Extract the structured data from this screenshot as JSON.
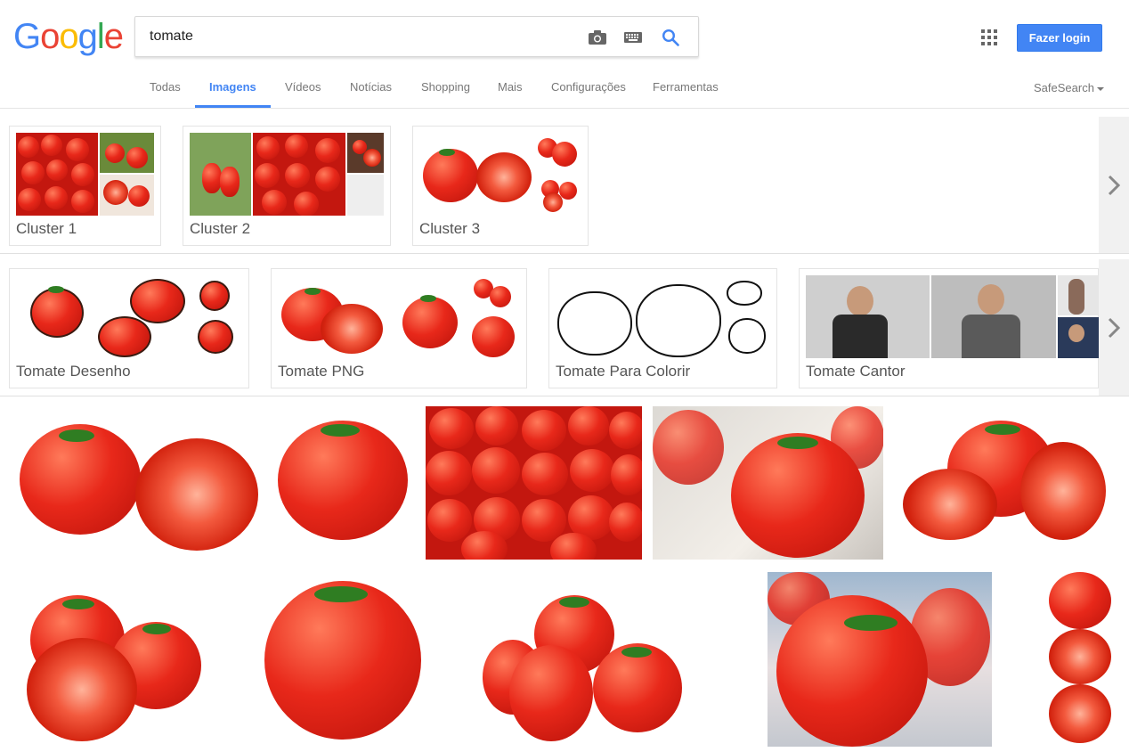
{
  "header": {
    "logo_letters": [
      "G",
      "o",
      "o",
      "g",
      "l",
      "e"
    ],
    "logo_colors": [
      "#4285f4",
      "#ea4335",
      "#fbbc05",
      "#4285f4",
      "#34a853",
      "#ea4335"
    ],
    "search_value": "tomate",
    "login_label": "Fazer login",
    "icons": [
      "camera-icon",
      "keyboard-icon",
      "search-icon",
      "apps-grid-icon"
    ]
  },
  "tabs": {
    "items": [
      "Todas",
      "Imagens",
      "Vídeos",
      "Notícias",
      "Shopping",
      "Mais",
      "Configurações",
      "Ferramentas"
    ],
    "active": "Imagens",
    "safesearch_label": "SafeSearch"
  },
  "clusters": [
    "Cluster 1",
    "Cluster 2",
    "Cluster 3"
  ],
  "related": [
    "Tomate Desenho",
    "Tomate PNG",
    "Tomate Para Colorir",
    "Tomate Cantor"
  ],
  "colors": {
    "accent": "#4285f4",
    "tomato": "#e8281a"
  }
}
